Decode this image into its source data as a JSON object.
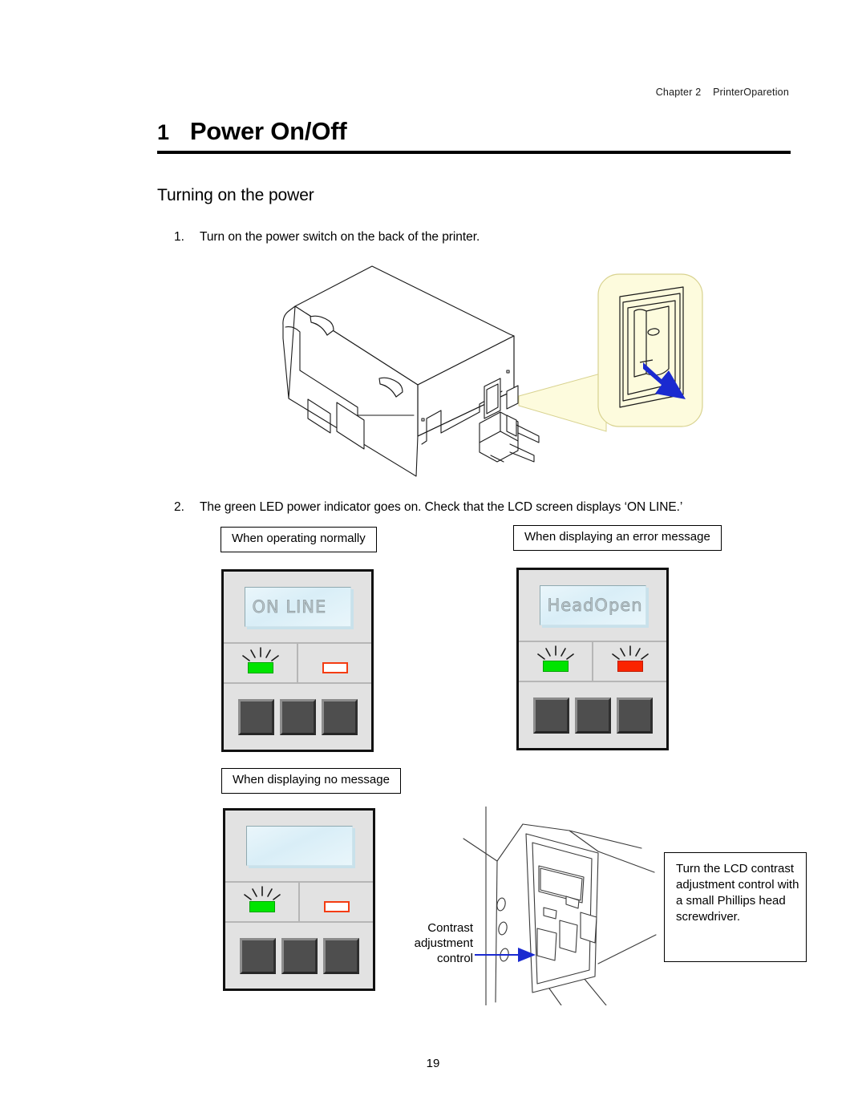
{
  "header": {
    "running_head": "Chapter 2    PrinterOparetion"
  },
  "title": {
    "number": "1",
    "text": "Power On/Off"
  },
  "section": {
    "heading": "Turning on the power"
  },
  "steps": [
    {
      "number": "1.",
      "text": "Turn on the power switch on the back of the printer."
    },
    {
      "number": "2.",
      "text": "The green LED power indicator goes on. Check that the LCD screen displays ‘ON LINE.’"
    }
  ],
  "figure_printer": {
    "name": "printer-rear-view",
    "callout": {
      "name": "power-switch-callout",
      "fill": "#fdfbdd",
      "arrow_color": "#1a2ad0"
    }
  },
  "panels": [
    {
      "id": "normal",
      "caption": "When operating normally",
      "lcd_text": "ON LINE",
      "green_led": {
        "state": "on",
        "color": "#00e400"
      },
      "red_led": {
        "state": "off",
        "color": "#f43c12"
      },
      "buttons": 3
    },
    {
      "id": "error",
      "caption": "When displaying an error message",
      "lcd_text": "HeadOpen",
      "green_led": {
        "state": "on",
        "color": "#00e400"
      },
      "red_led": {
        "state": "on",
        "color": "#fa2400"
      },
      "buttons": 3
    },
    {
      "id": "no-message",
      "caption": "When displaying no message",
      "lcd_text": "",
      "green_led": {
        "state": "on",
        "color": "#00e400"
      },
      "red_led": {
        "state": "off",
        "color": "#f43c12"
      },
      "buttons": 3
    }
  ],
  "contrast": {
    "label_lines": [
      "Contrast",
      "adjustment",
      "control"
    ],
    "arrow_color": "#1a2ad0",
    "note": "Turn the LCD contrast adjustment control with a small Phillips head screwdriver."
  },
  "folio": {
    "page_number": "19"
  }
}
